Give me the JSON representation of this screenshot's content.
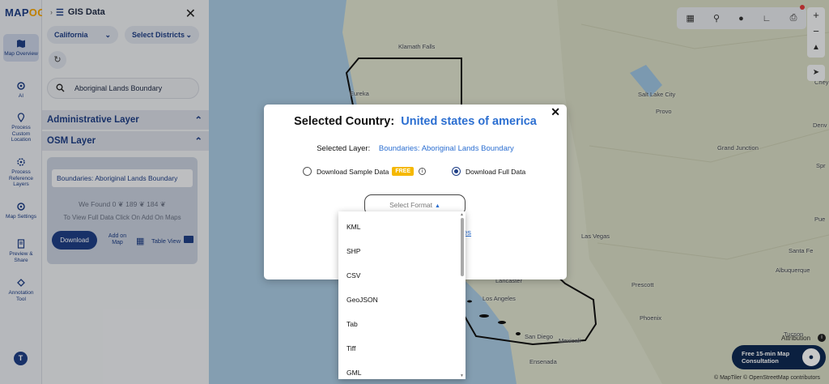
{
  "app": {
    "logo_main": "MAP",
    "logo_accent": "OG"
  },
  "rail": {
    "items": [
      {
        "label": "Map Overview"
      },
      {
        "label": "AI"
      },
      {
        "label": "Process Custom Location"
      },
      {
        "label": "Process Reference Layers"
      },
      {
        "label": "Map Settings"
      },
      {
        "label": "Preview & Share"
      },
      {
        "label": "Annotation Tool"
      }
    ],
    "avatar": "T"
  },
  "panel": {
    "title": "GIS Data",
    "country_select": "California",
    "district_select": "Select Districts",
    "search_value": "Aboriginal Lands Boundary",
    "admin_section": "Administrative Layer",
    "osm_section": "OSM Layer",
    "layer_chip": "Boundaries: Aboriginal Lands Boundary",
    "found_text": "We Found  0 ❦  189 ❦  184 ❦",
    "tofull_text": "To View Full Data Click On Add On Maps",
    "download_label": "Download",
    "addon_label": "Add on Map",
    "tableview_label": "Table View"
  },
  "map": {
    "labels": {
      "klamath": "Klamath Falls",
      "eureka": "Eureka",
      "saltlake": "Salt Lake City",
      "provo": "Provo",
      "denver": "Denv",
      "grandjunction": "Grand Junction",
      "lasvegas": "Las Vegas",
      "lancaster": "Lancaster",
      "losangeles": "Los Angeles",
      "sandiego": "San Diego",
      "mexicali": "Mexicali",
      "ensenada": "Ensenada",
      "phoenix": "Phoenix",
      "prescott": "Prescott",
      "santafe": "Santa Fe",
      "albuquerque": "Albuquerque",
      "tucson": "Tucson",
      "spr": "Spr",
      "chey": "Chey",
      "pue": "Pue"
    },
    "attribution_link": "Attribution",
    "copyright": "© MapTiler © OpenStreetMap contributors",
    "consult_label": "Free 15-min Map Consultation"
  },
  "modal": {
    "title_prefix": "Selected Country:",
    "country": "United states of america",
    "layer_label": "Selected Layer:",
    "layer_value": "Boundaries: Aboriginal Lands Boundary",
    "sample_label": "Download Sample Data",
    "free_badge": "FREE",
    "full_label": "Download Full Data",
    "format_placeholder": "Select Format",
    "link_partial": "es"
  },
  "dropdown": {
    "options": [
      "KML",
      "SHP",
      "CSV",
      "GeoJSON",
      "Tab",
      "Tiff",
      "GML"
    ]
  },
  "colors": {
    "brand": "#1f3f86",
    "accent": "#2c6fd1",
    "free": "#f5b800",
    "consult": "#0f2a52"
  }
}
